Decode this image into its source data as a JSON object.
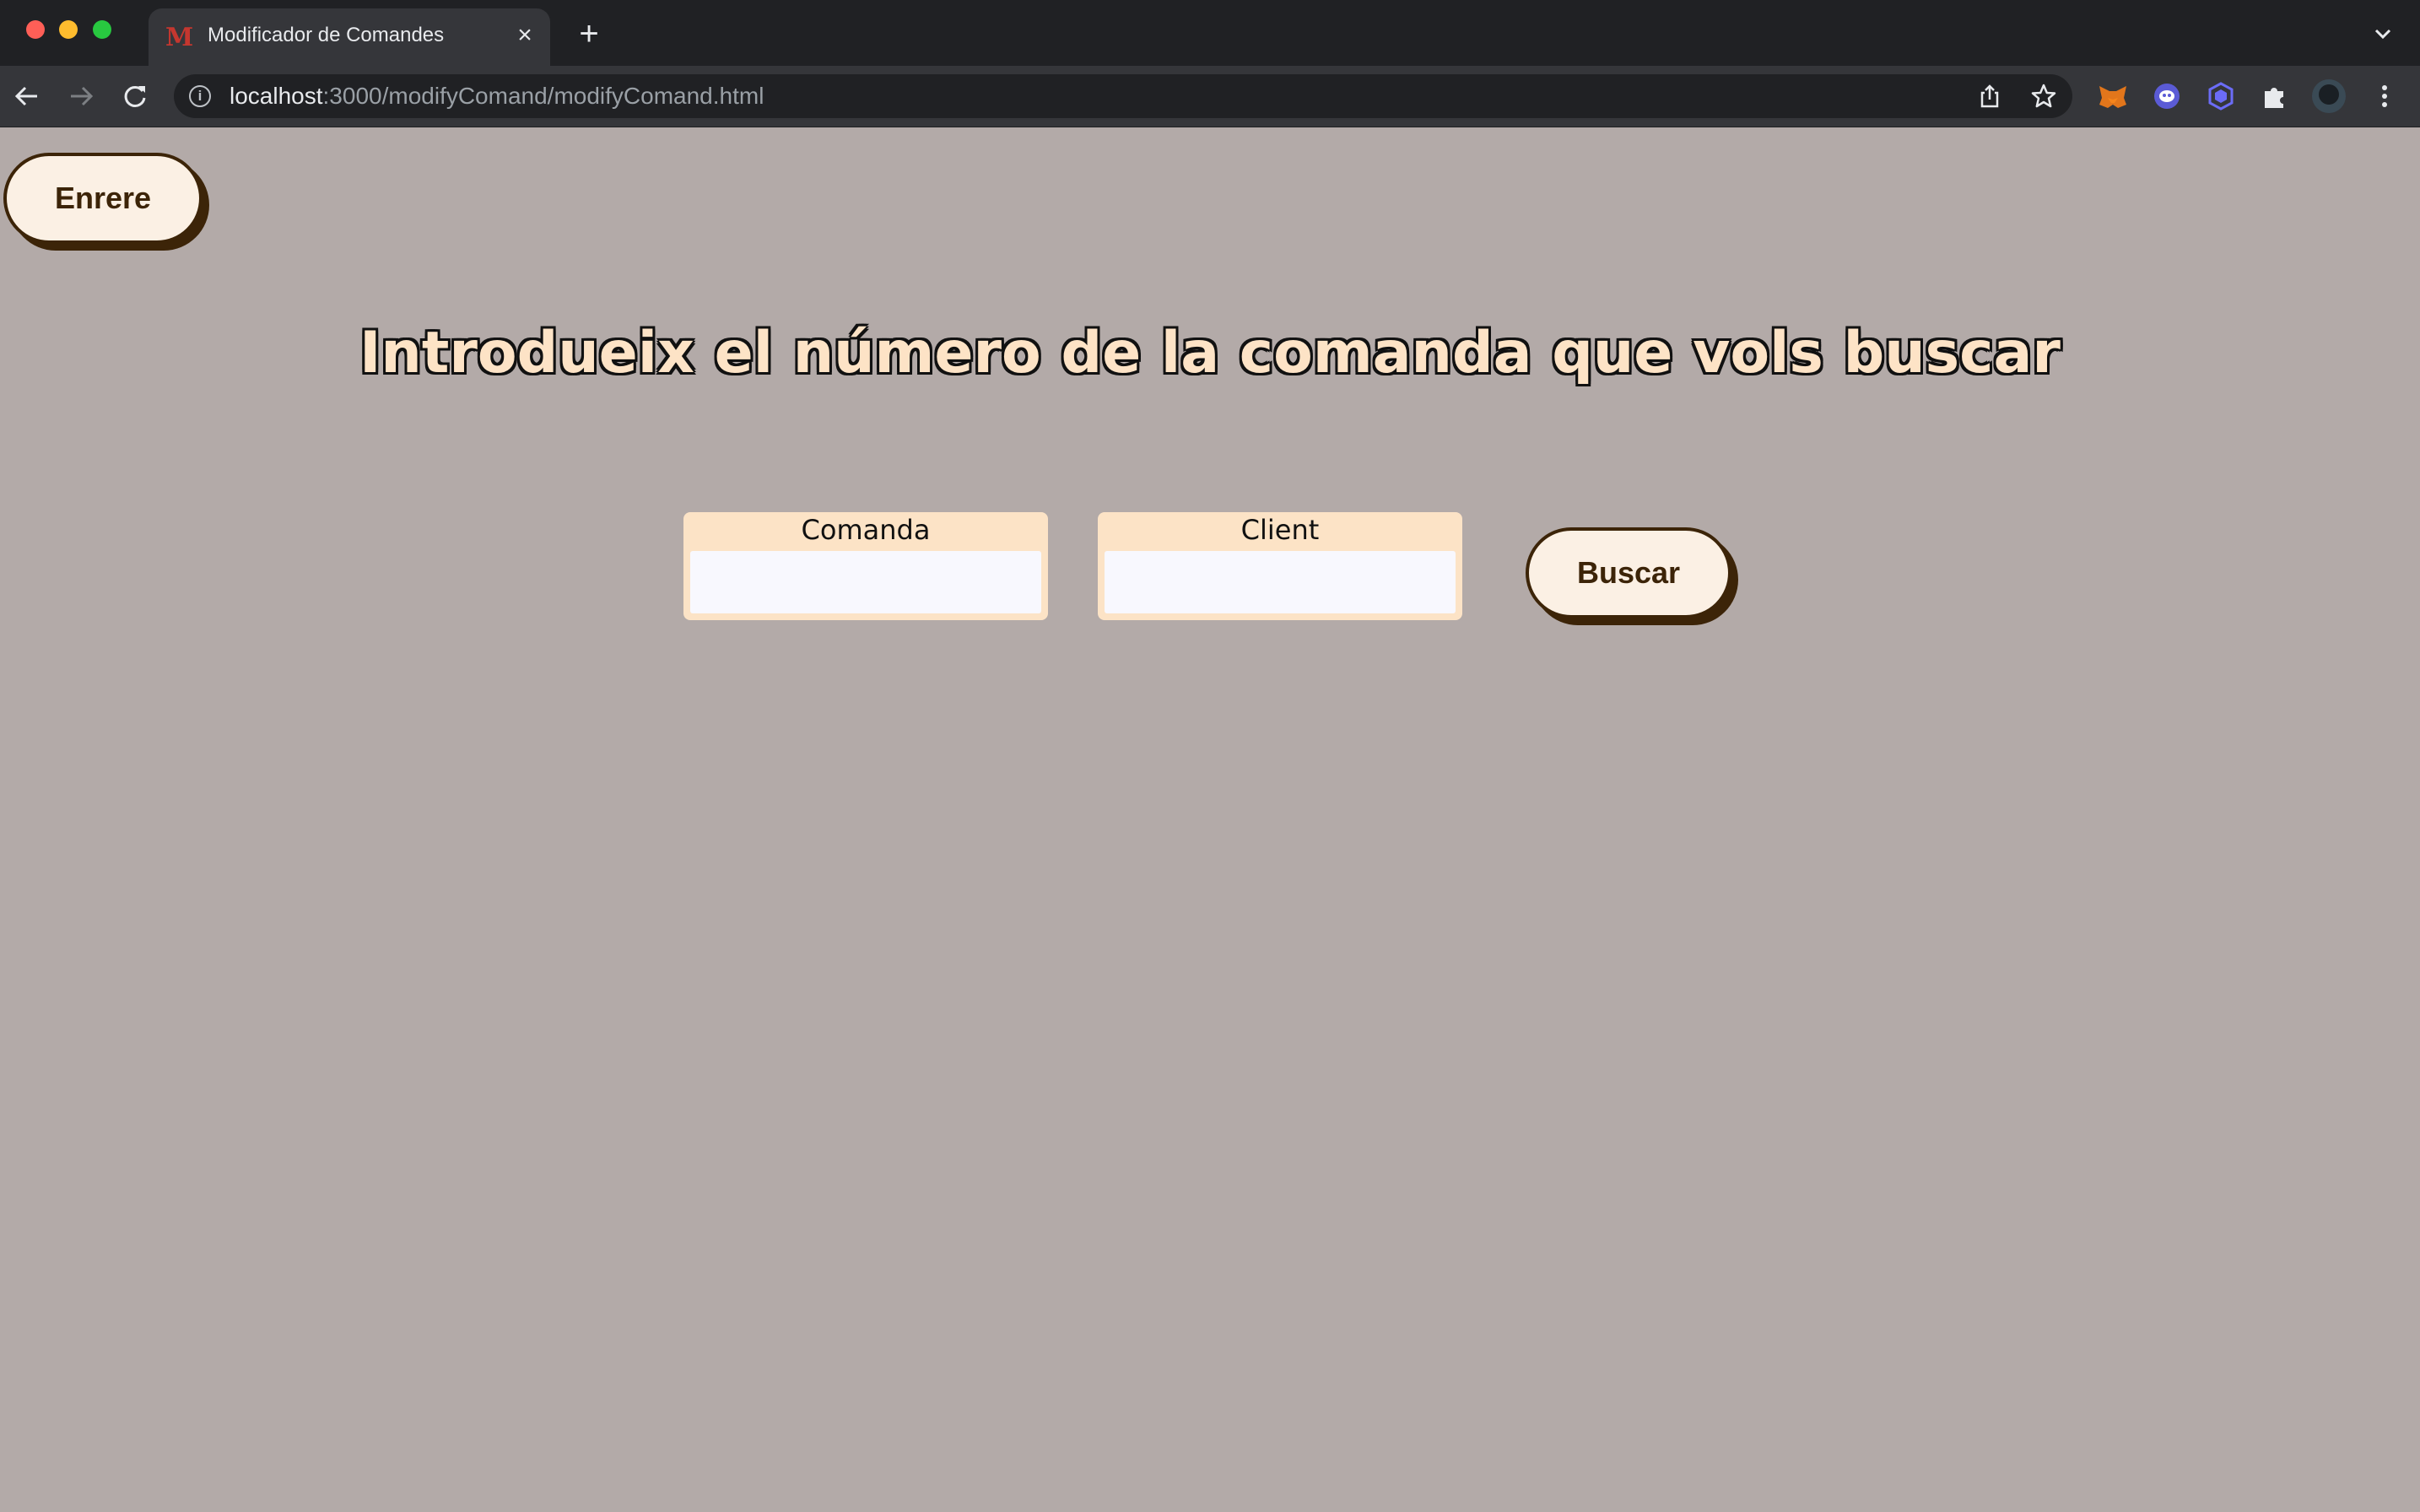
{
  "browser": {
    "tab_title": "Modificador de Comandes",
    "url_host": "localhost",
    "url_rest": ":3000/modifyComand/modifyComand.html"
  },
  "page": {
    "back_label": "Enrere",
    "heading": "Introdueix el número de la comanda que vols buscar",
    "fields": {
      "comanda": {
        "label": "Comanda",
        "value": "",
        "placeholder": ""
      },
      "client": {
        "label": "Client",
        "value": "",
        "placeholder": ""
      }
    },
    "search_label": "Buscar"
  },
  "colors": {
    "page_background": "#b3aaa8",
    "button_fill": "#fbf0e4",
    "button_border": "#3c2408",
    "field_background": "#fce3c6",
    "heading_fill": "#fde3c6"
  },
  "icons": [
    "favicon-m-icon",
    "close-icon",
    "plus-icon",
    "chevron-down-icon",
    "back-arrow-icon",
    "forward-arrow-icon",
    "reload-icon",
    "info-icon",
    "share-icon",
    "star-icon",
    "metamask-icon",
    "extension-ghost-icon",
    "extension-shield-icon",
    "puzzle-icon",
    "avatar",
    "kebab-menu-icon"
  ]
}
